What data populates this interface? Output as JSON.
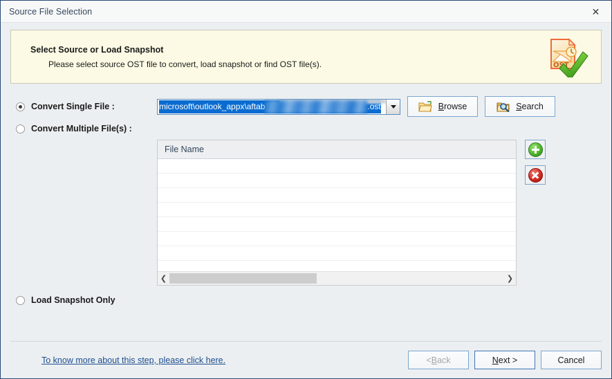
{
  "window": {
    "title": "Source File Selection",
    "close_label": "✕",
    "close_icon": "close-icon"
  },
  "banner": {
    "title": "Select Source or Load Snapshot",
    "subtitle": "Please select source OST file to convert, load snapshot or find OST file(s).",
    "icon": "ost-file-checkmark-icon",
    "bg_color": "#FCFAE4",
    "border_color": "#C9C9BB"
  },
  "options": {
    "single": {
      "label": "Convert Single File :",
      "selected": true
    },
    "multiple": {
      "label": "Convert Multiple File(s) :",
      "selected": false
    },
    "snapshot": {
      "label": "Load Snapshot Only",
      "selected": false
    }
  },
  "path_combo": {
    "value_prefix": "microsoft\\outlook_appx\\aftab",
    "value_suffix": ".ost",
    "redacted": true,
    "selected": true,
    "selection_color": "#0A6CD0",
    "dropdown_icon": "chevron-down-icon"
  },
  "buttons": {
    "browse": {
      "label": "Browse",
      "accel": "B",
      "icon": "folder-open-icon"
    },
    "search": {
      "label": "Search",
      "accel": "S",
      "icon": "folder-search-icon"
    },
    "add": {
      "icon": "add-circle-icon",
      "color": "#52B82E"
    },
    "remove": {
      "icon": "remove-circle-icon",
      "color": "#D32A22"
    },
    "back": {
      "label": "< Back",
      "accel": "B",
      "disabled": true
    },
    "next": {
      "label": "Next >",
      "accel": "N",
      "default": true
    },
    "cancel": {
      "label": "Cancel",
      "disabled": false
    }
  },
  "file_list": {
    "column_header": "File Name",
    "rows": [],
    "empty_row_count": 8,
    "scrollbar": {
      "left_icon": "chevron-left-icon",
      "right_icon": "chevron-right-icon",
      "thumb_fraction": 0.42
    }
  },
  "footer": {
    "help_link": "To know more about this step, please click here."
  }
}
